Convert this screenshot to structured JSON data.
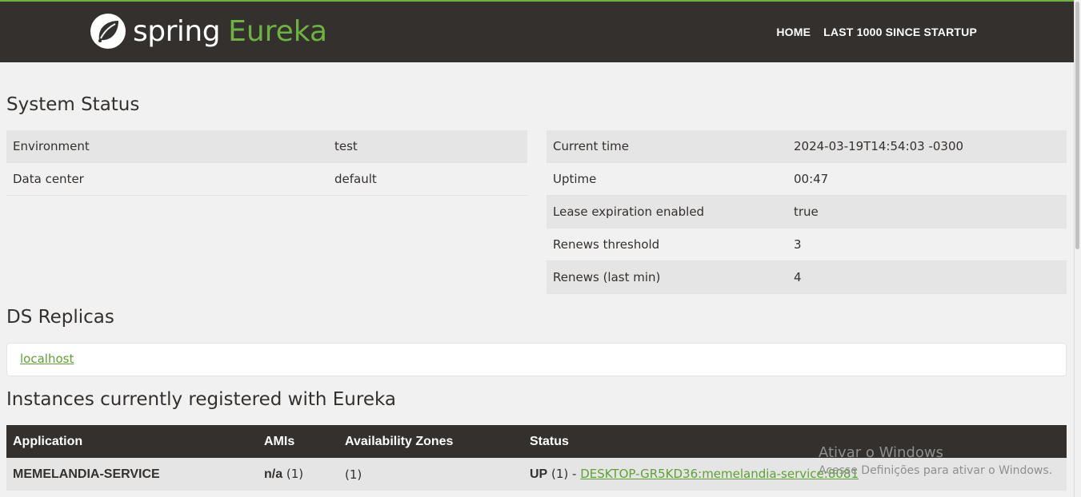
{
  "nav": {
    "brand_spring": "spring",
    "brand_eureka": "Eureka",
    "home": "HOME",
    "last1000": "LAST 1000 SINCE STARTUP"
  },
  "system_status": {
    "title": "System Status",
    "left": [
      {
        "label": "Environment",
        "value": "test"
      },
      {
        "label": "Data center",
        "value": "default"
      }
    ],
    "right": [
      {
        "label": "Current time",
        "value": "2024-03-19T14:54:03 -0300"
      },
      {
        "label": "Uptime",
        "value": "00:47"
      },
      {
        "label": "Lease expiration enabled",
        "value": "true"
      },
      {
        "label": "Renews threshold",
        "value": "3"
      },
      {
        "label": "Renews (last min)",
        "value": "4"
      }
    ]
  },
  "replicas": {
    "title": "DS Replicas",
    "link": "localhost"
  },
  "instances": {
    "title": "Instances currently registered with Eureka",
    "headers": [
      "Application",
      "AMIs",
      "Availability Zones",
      "Status"
    ],
    "rows": [
      {
        "application": "MEMELANDIA-SERVICE",
        "amis_bold": "n/a",
        "amis_count": " (1)",
        "zones": "(1)",
        "status_bold": "UP",
        "status_prefix": " (1) - ",
        "status_link": "DESKTOP-GR5KD36:memelandia-service:8081"
      }
    ]
  },
  "watermark": {
    "title": "Ativar o Windows",
    "subtitle": "Acesse Definições para ativar o Windows."
  },
  "colors": {
    "nav_bg": "#34302d",
    "accent": "#6db33f",
    "link": "#5fa134"
  }
}
